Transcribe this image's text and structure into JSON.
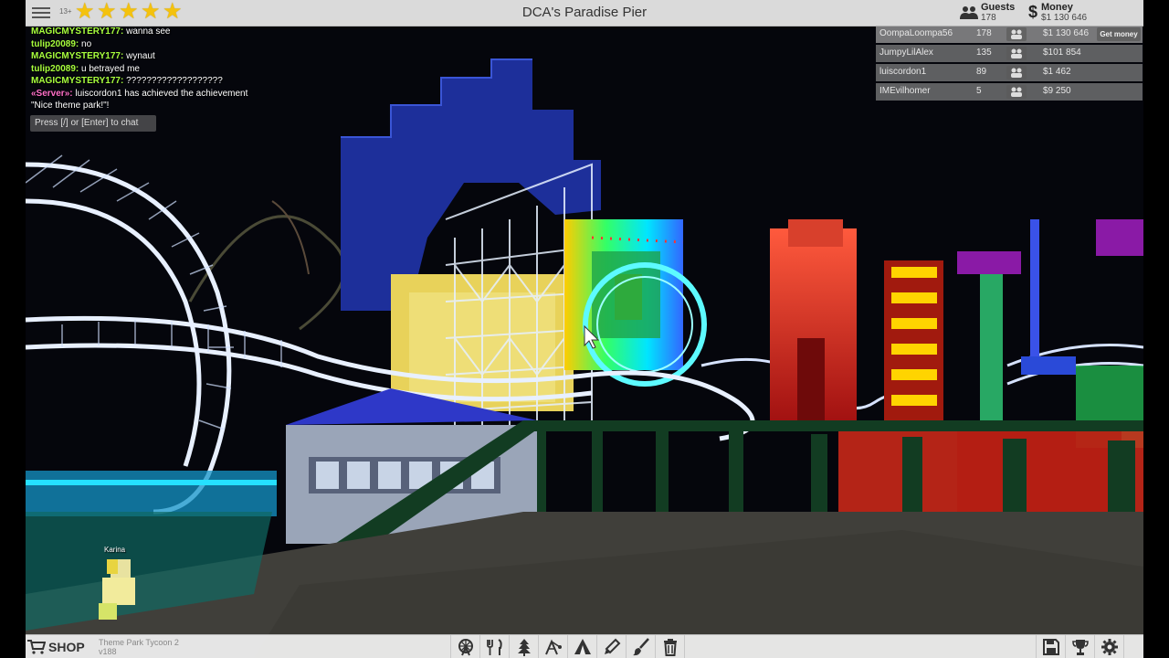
{
  "topbar": {
    "age_badge": "13+",
    "rating_stars": 5,
    "park_name": "DCA's Paradise Pier",
    "guests_label": "Guests",
    "guests_value": "178",
    "money_symbol": "$",
    "money_label": "Money",
    "money_value": "$1 130 646"
  },
  "chat": {
    "messages": [
      {
        "name": "MAGICMYSTERY177:",
        "text": " wanna see",
        "color": "#a8ff3d"
      },
      {
        "name": "tulip20089:",
        "text": " no",
        "color": "#a8ff3d"
      },
      {
        "name": "MAGICMYSTERY177:",
        "text": " wynaut",
        "color": "#a8ff3d"
      },
      {
        "name": "tulip20089:",
        "text": " u betrayed me",
        "color": "#a8ff3d"
      },
      {
        "name": "MAGICMYSTERY177:",
        "text": " ???????????????????",
        "color": "#a8ff3d"
      },
      {
        "name": "«Server»:",
        "text": " luiscordon1 has achieved the achievement",
        "color": "#ff6fc8"
      },
      {
        "name": "",
        "text": "\"Nice theme park!\"!",
        "color": "#ffffff"
      }
    ],
    "input_placeholder": "Press [/] or [Enter] to chat"
  },
  "leaderboard": [
    {
      "name": "OompaLoompa56",
      "guests": "178",
      "money": "$1 130 646",
      "button": "Get money"
    },
    {
      "name": "JumpyLilAlex",
      "guests": "135",
      "money": "$101 854",
      "button": ""
    },
    {
      "name": "luiscordon1",
      "guests": "89",
      "money": "$1 462",
      "button": ""
    },
    {
      "name": "IMEvilhomer",
      "guests": "5",
      "money": "$9 250",
      "button": ""
    }
  ],
  "player_name": "Karina",
  "bottombar": {
    "shop_label": "SHOP",
    "game_name": "Theme Park Tycoon 2",
    "version": "v188",
    "tools": [
      "ferris-wheel-icon",
      "food-icon",
      "tree-icon",
      "ride-icon",
      "tent-icon",
      "paint-icon",
      "brush-icon",
      "trash-icon"
    ],
    "right_tools": [
      "save-icon",
      "trophy-icon",
      "settings-icon"
    ]
  },
  "colors": {
    "chat_name": "#a8ff3d",
    "server": "#ff6fc8",
    "star": "#f4c20d",
    "night_sky": "#06070d"
  }
}
